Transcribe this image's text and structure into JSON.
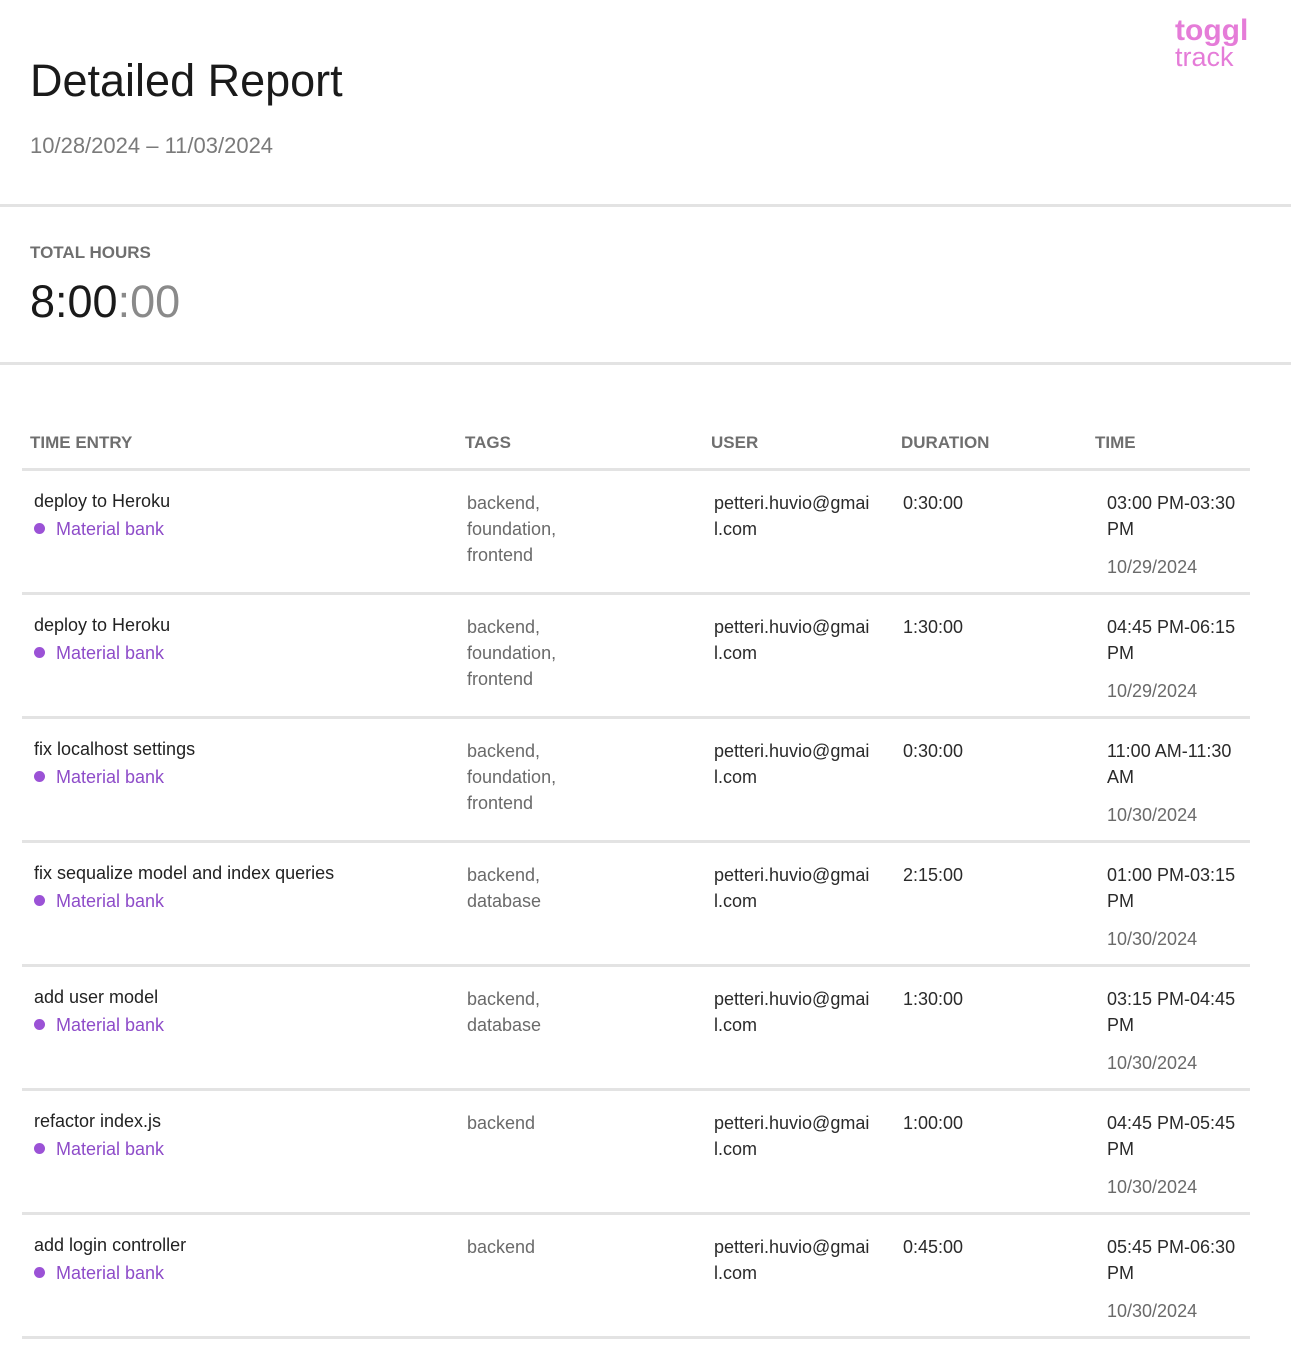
{
  "brand": {
    "logo_top": "toggl",
    "logo_bottom": "track",
    "color": "#e57cd8"
  },
  "report": {
    "title": "Detailed Report",
    "date_range": "10/28/2024 – 11/03/2024",
    "total_label": "TOTAL HOURS",
    "total_main": "8:00",
    "total_seconds": ":00"
  },
  "table": {
    "headers": [
      "TIME ENTRY",
      "TAGS",
      "USER",
      "DURATION",
      "TIME"
    ],
    "project_color": "#9b52d6",
    "rows": [
      {
        "description": "deploy to Heroku",
        "project": "Material bank",
        "tags": "backend, foundation, frontend",
        "user": "petteri.huvio@gmail.com",
        "duration": "0:30:00",
        "time": "03:00 PM-03:30 PM",
        "date": "10/29/2024"
      },
      {
        "description": "deploy to Heroku",
        "project": "Material bank",
        "tags": "backend, foundation, frontend",
        "user": "petteri.huvio@gmail.com",
        "duration": "1:30:00",
        "time": "04:45 PM-06:15 PM",
        "date": "10/29/2024"
      },
      {
        "description": "fix localhost settings",
        "project": "Material bank",
        "tags": "backend, foundation, frontend",
        "user": "petteri.huvio@gmail.com",
        "duration": "0:30:00",
        "time": "11:00 AM-11:30 AM",
        "date": "10/30/2024"
      },
      {
        "description": "fix sequalize model and index queries",
        "project": "Material bank",
        "tags": "backend, database",
        "user": "petteri.huvio@gmail.com",
        "duration": "2:15:00",
        "time": "01:00 PM-03:15 PM",
        "date": "10/30/2024"
      },
      {
        "description": "add user model",
        "project": "Material bank",
        "tags": "backend, database",
        "user": "petteri.huvio@gmail.com",
        "duration": "1:30:00",
        "time": "03:15 PM-04:45 PM",
        "date": "10/30/2024"
      },
      {
        "description": "refactor index.js",
        "project": "Material bank",
        "tags": "backend",
        "user": "petteri.huvio@gmail.com",
        "duration": "1:00:00",
        "time": "04:45 PM-05:45 PM",
        "date": "10/30/2024"
      },
      {
        "description": "add login controller",
        "project": "Material bank",
        "tags": "backend",
        "user": "petteri.huvio@gmail.com",
        "duration": "0:45:00",
        "time": "05:45 PM-06:30 PM",
        "date": "10/30/2024"
      }
    ]
  }
}
